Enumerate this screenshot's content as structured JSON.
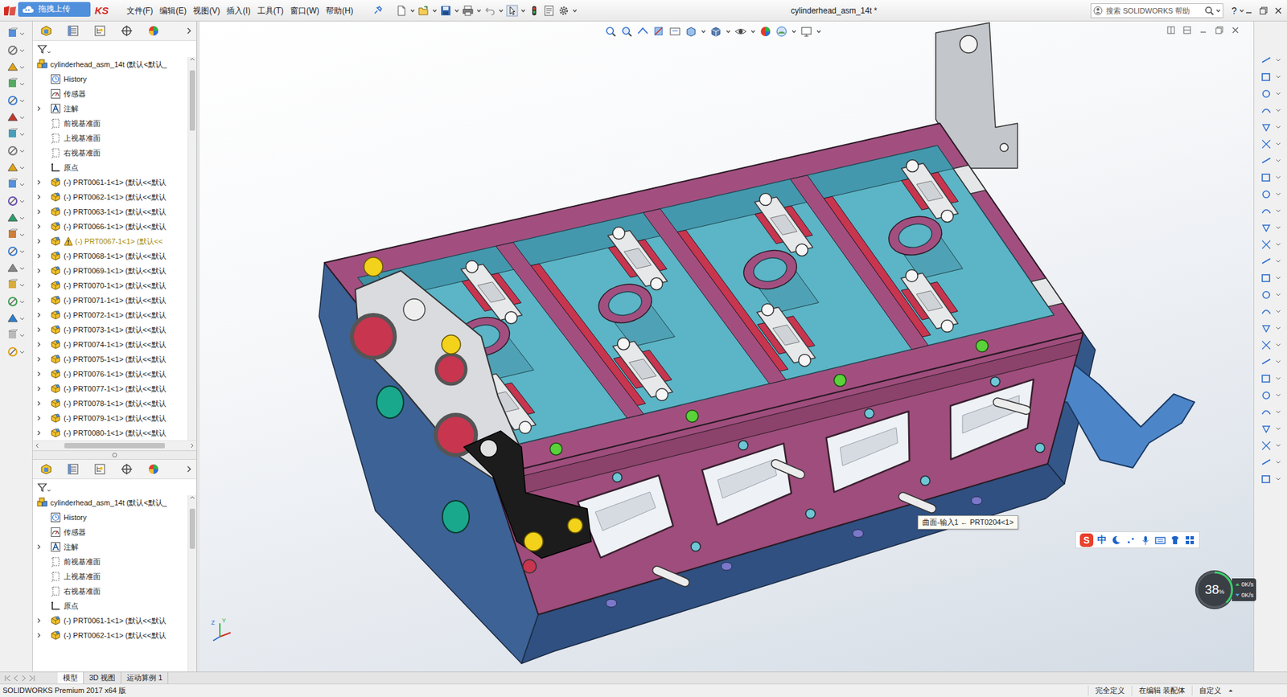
{
  "window": {
    "title": "cylinderhead_asm_14t *"
  },
  "upload_badge": "拖拽上传",
  "logo_tail": "KS",
  "menu": [
    "文件(F)",
    "编辑(E)",
    "视图(V)",
    "插入(I)",
    "工具(T)",
    "窗口(W)",
    "帮助(H)"
  ],
  "search": {
    "placeholder": "搜索 SOLIDWORKS 帮助"
  },
  "help_button": "?",
  "tree_panes": [
    {
      "root": {
        "label": "cylinderhead_asm_14t  (默认<默认_"
      },
      "items": [
        {
          "label": "History",
          "kind": "history",
          "expandable": false,
          "warning": false
        },
        {
          "label": "传感器",
          "kind": "sensor",
          "expandable": false,
          "warning": false
        },
        {
          "label": "注解",
          "kind": "annotation",
          "expandable": true,
          "warning": false
        },
        {
          "label": "前视基准面",
          "kind": "plane",
          "expandable": false,
          "warning": false
        },
        {
          "label": "上视基准面",
          "kind": "plane",
          "expandable": false,
          "warning": false
        },
        {
          "label": "右视基准面",
          "kind": "plane",
          "expandable": false,
          "warning": false
        },
        {
          "label": "原点",
          "kind": "origin",
          "expandable": false,
          "warning": false
        },
        {
          "label": "(-) PRT0061-1<1> (默认<<默认",
          "kind": "part",
          "expandable": true,
          "warning": false
        },
        {
          "label": "(-) PRT0062-1<1> (默认<<默认",
          "kind": "part",
          "expandable": true,
          "warning": false
        },
        {
          "label": "(-) PRT0063-1<1> (默认<<默认",
          "kind": "part",
          "expandable": true,
          "warning": false
        },
        {
          "label": "(-) PRT0066-1<1> (默认<<默认",
          "kind": "part",
          "expandable": true,
          "warning": false
        },
        {
          "label": "(-) PRT0067-1<1> (默认<<",
          "kind": "part",
          "expandable": true,
          "warning": true
        },
        {
          "label": "(-) PRT0068-1<1> (默认<<默认",
          "kind": "part",
          "expandable": true,
          "warning": false
        },
        {
          "label": "(-) PRT0069-1<1> (默认<<默认",
          "kind": "part",
          "expandable": true,
          "warning": false
        },
        {
          "label": "(-) PRT0070-1<1> (默认<<默认",
          "kind": "part",
          "expandable": true,
          "warning": false
        },
        {
          "label": "(-) PRT0071-1<1> (默认<<默认",
          "kind": "part",
          "expandable": true,
          "warning": false
        },
        {
          "label": "(-) PRT0072-1<1> (默认<<默认",
          "kind": "part",
          "expandable": true,
          "warning": false
        },
        {
          "label": "(-) PRT0073-1<1> (默认<<默认",
          "kind": "part",
          "expandable": true,
          "warning": false
        },
        {
          "label": "(-) PRT0074-1<1> (默认<<默认",
          "kind": "part",
          "expandable": true,
          "warning": false
        },
        {
          "label": "(-) PRT0075-1<1> (默认<<默认",
          "kind": "part",
          "expandable": true,
          "warning": false
        },
        {
          "label": "(-) PRT0076-1<1> (默认<<默认",
          "kind": "part",
          "expandable": true,
          "warning": false
        },
        {
          "label": "(-) PRT0077-1<1> (默认<<默认",
          "kind": "part",
          "expandable": true,
          "warning": false
        },
        {
          "label": "(-) PRT0078-1<1> (默认<<默认",
          "kind": "part",
          "expandable": true,
          "warning": false
        },
        {
          "label": "(-) PRT0079-1<1> (默认<<默认",
          "kind": "part",
          "expandable": true,
          "warning": false
        },
        {
          "label": "(-) PRT0080-1<1> (默认<<默认",
          "kind": "part",
          "expandable": true,
          "warning": false
        }
      ]
    },
    {
      "root": {
        "label": "cylinderhead_asm_14t  (默认<默认_"
      },
      "items": [
        {
          "label": "History",
          "kind": "history",
          "expandable": false,
          "warning": false
        },
        {
          "label": "传感器",
          "kind": "sensor",
          "expandable": false,
          "warning": false
        },
        {
          "label": "注解",
          "kind": "annotation",
          "expandable": true,
          "warning": false
        },
        {
          "label": "前视基准面",
          "kind": "plane",
          "expandable": false,
          "warning": false
        },
        {
          "label": "上视基准面",
          "kind": "plane",
          "expandable": false,
          "warning": false
        },
        {
          "label": "右视基准面",
          "kind": "plane",
          "expandable": false,
          "warning": false
        },
        {
          "label": "原点",
          "kind": "origin",
          "expandable": false,
          "warning": false
        },
        {
          "label": "(-) PRT0061-1<1> (默认<<默认",
          "kind": "part",
          "expandable": true,
          "warning": false
        },
        {
          "label": "(-) PRT0062-1<1> (默认<<默认",
          "kind": "part",
          "expandable": true,
          "warning": false
        }
      ]
    }
  ],
  "viewport": {
    "tooltip": "曲面-输入1 ← PRT0204<1>",
    "axis_labels": [
      "Z",
      "Y"
    ]
  },
  "ime": {
    "logo": "S",
    "mode": "中"
  },
  "net_monitor": {
    "percent": "38",
    "unit": "%",
    "upload": "0K/s",
    "download": "0K/s",
    "level": 0.38
  },
  "bottom_tabs": [
    {
      "label": "模型",
      "selected": true
    },
    {
      "label": "3D 视图",
      "selected": false
    },
    {
      "label": "运动算例 1",
      "selected": false
    }
  ],
  "status_bar": {
    "product": "SOLIDWORKS Premium 2017 x64 版",
    "items": [
      "完全定义",
      "在编辑 装配体",
      "自定义"
    ]
  }
}
